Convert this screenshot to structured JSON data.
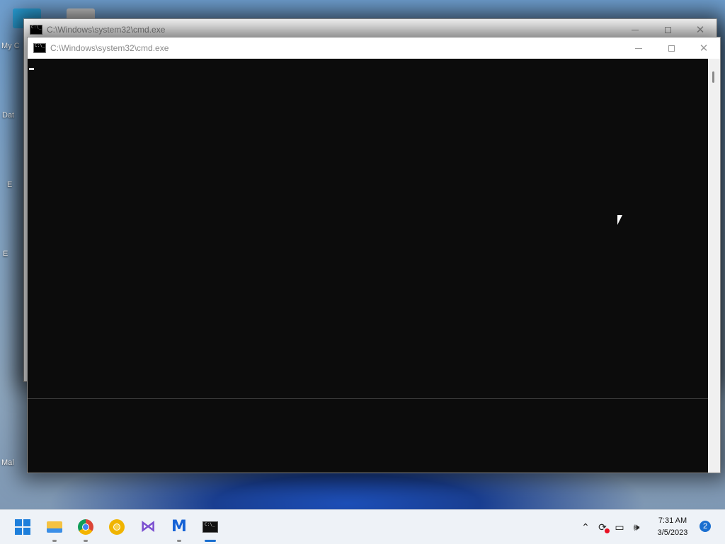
{
  "desktop": {
    "icons": [
      "My C",
      "Dat",
      "E",
      "E",
      "Mal"
    ]
  },
  "windows": [
    {
      "title": "C:\\Windows\\system32\\cmd.exe"
    },
    {
      "title": "C:\\Windows\\system32\\cmd.exe"
    }
  ],
  "taskbar": {
    "apps": [
      "start",
      "file-explorer",
      "google-chrome",
      "chrome-canary",
      "visual-studio",
      "malwarebytes",
      "command-prompt"
    ],
    "active_app": "command-prompt",
    "clock_time": "7:31 AM",
    "clock_date": "3/5/2023",
    "notification_count": "2"
  },
  "colors": {
    "console_bg": "#0c0c0c",
    "accent": "#1a6fd0",
    "taskbar_bg": "#eef2f7"
  }
}
